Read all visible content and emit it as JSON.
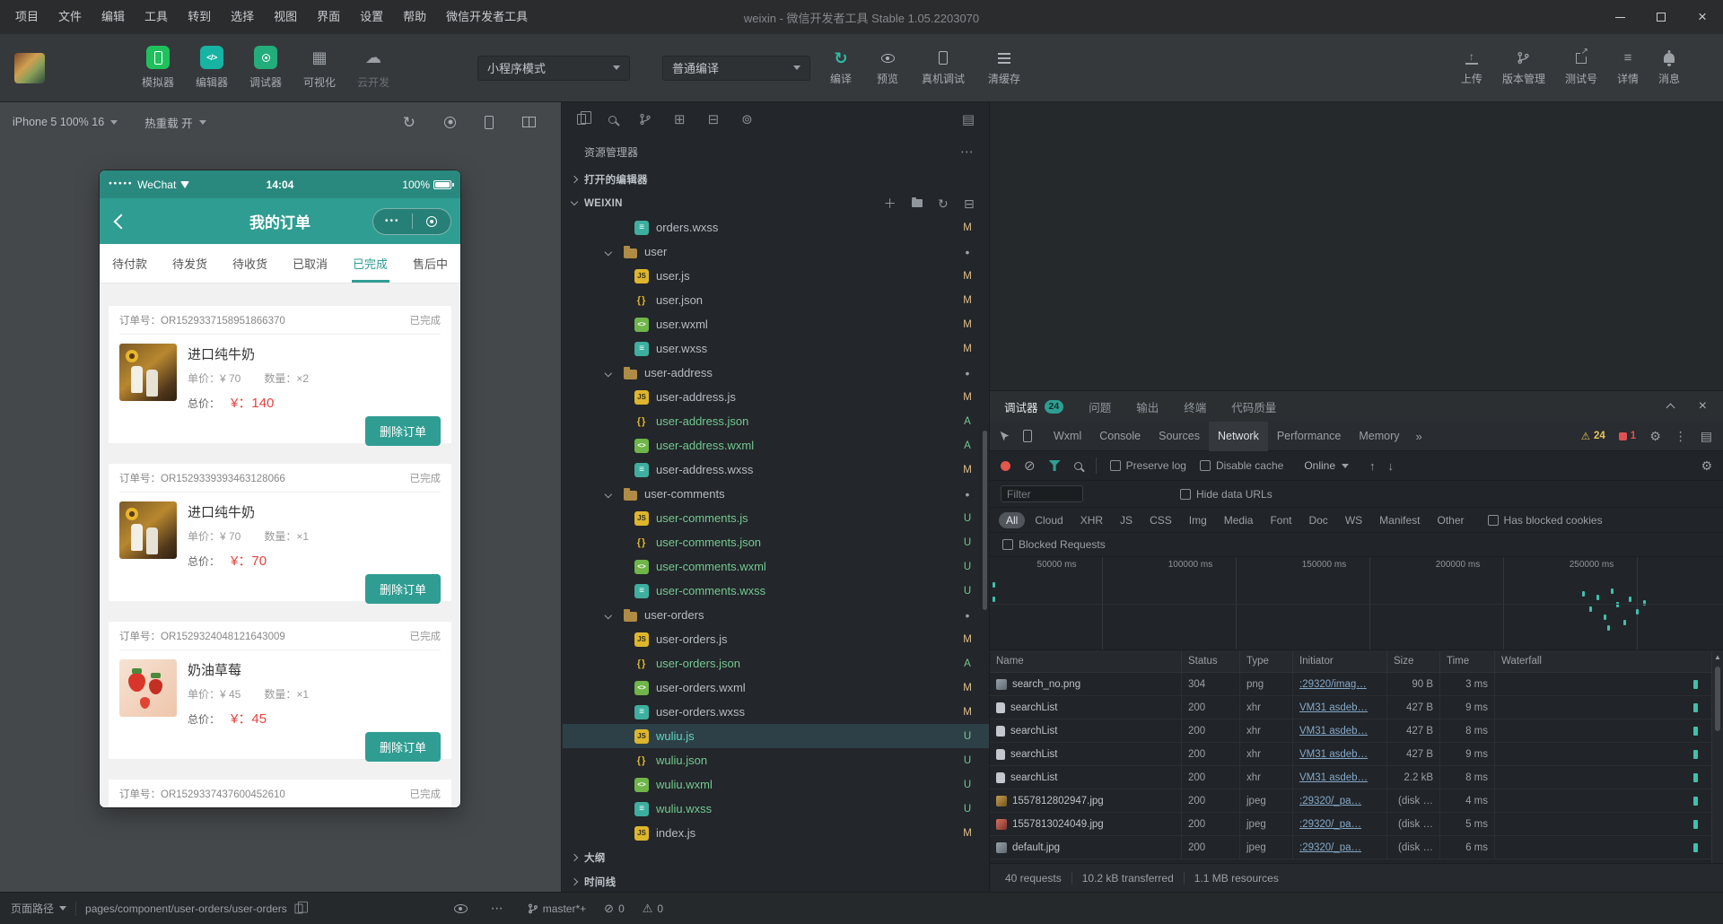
{
  "colors": {
    "accent_teal": "#2f9d92",
    "price_red": "#e64340",
    "badge_modified": "#e2c08d",
    "badge_added_untracked": "#73c991",
    "warning_yellow": "#e8c65a",
    "error_red": "#e05252"
  },
  "icons": {
    "refresh": "↻",
    "clear": "⊘",
    "error": "⊘",
    "gear": "⚙",
    "warning": "⚠",
    "more_v": "⋮",
    "more_h": "⋯",
    "overflow": "»",
    "grid": "▦",
    "cloud": "☁",
    "panel": "▤",
    "extensions": "⊞",
    "package": "⊟",
    "container": "⊚",
    "collapse_all": "⊟",
    "add": "＋",
    "up": "↑",
    "down": "↓",
    "external": "↗",
    "close": "×",
    "dots3": "•••",
    "signal": "●●●●●",
    "sort_up": "▲",
    "code": "</>"
  },
  "menu": {
    "items": [
      "项目",
      "文件",
      "编辑",
      "工具",
      "转到",
      "选择",
      "视图",
      "界面",
      "设置",
      "帮助",
      "微信开发者工具"
    ],
    "title": "weixin - 微信开发者工具 Stable 1.05.2203070"
  },
  "toolbar": {
    "modes": [
      {
        "label": "模拟器"
      },
      {
        "label": "编辑器"
      },
      {
        "label": "调试器"
      },
      {
        "label": "可视化"
      },
      {
        "label": "云开发"
      }
    ],
    "scheme": "小程序模式",
    "compile_mode": "普通编译",
    "compile": "编译",
    "preview": "预览",
    "device_debug": "真机调试",
    "clear_cache": "清缓存",
    "upload": "上传",
    "version": "版本管理",
    "test_account": "测试号",
    "details": "详情",
    "messages": "消息"
  },
  "simulator": {
    "device": "iPhone 5 100% 16",
    "hot_reload": "热重载 开"
  },
  "phone": {
    "carrier": "WeChat",
    "time": "14:04",
    "battery": "100%",
    "nav_title": "我的订单",
    "tabs": [
      {
        "label": "待付款",
        "active": false
      },
      {
        "label": "待发货",
        "active": false
      },
      {
        "label": "待收货",
        "active": false
      },
      {
        "label": "已取消",
        "active": false
      },
      {
        "label": "已完成",
        "active": true
      },
      {
        "label": "售后中",
        "active": false
      }
    ],
    "orders": [
      {
        "order_no": "订单号：OR1529337158951866370",
        "status": "已完成",
        "product": "进口纯牛奶",
        "unit_price": "单价：¥ 70",
        "quantity": "数量：×2",
        "total_label": "总价：",
        "total": "¥：140",
        "image": "milk",
        "delete_label": "删除订单"
      },
      {
        "order_no": "订单号：OR1529339393463128066",
        "status": "已完成",
        "product": "进口纯牛奶",
        "unit_price": "单价：¥ 70",
        "quantity": "数量：×1",
        "total_label": "总价：",
        "total": "¥：70",
        "image": "milk",
        "delete_label": "删除订单"
      },
      {
        "order_no": "订单号：OR1529324048121643009",
        "status": "已完成",
        "product": "奶油草莓",
        "unit_price": "单价：¥ 45",
        "quantity": "数量：×1",
        "total_label": "总价：",
        "total": "¥：45",
        "image": "strawberry",
        "delete_label": "删除订单"
      }
    ],
    "next_order": {
      "order_no": "订单号：OR1529337437600452610",
      "status": "已完成"
    }
  },
  "explorer": {
    "title": "资源管理器",
    "open_editors": "打开的编辑器",
    "project": "WEIXIN",
    "outline": "大纲",
    "timeline": "时间线",
    "tree": [
      {
        "name": "orders.wxss",
        "icon": "wxss",
        "badge": "M",
        "kind": "file"
      },
      {
        "name": "user",
        "icon": "folder",
        "badge": "•",
        "kind": "folder"
      },
      {
        "name": "user.js",
        "icon": "js",
        "badge": "M",
        "kind": "file"
      },
      {
        "name": "user.json",
        "icon": "json",
        "badge": "M",
        "kind": "file"
      },
      {
        "name": "user.wxml",
        "icon": "wxml",
        "badge": "M",
        "kind": "file"
      },
      {
        "name": "user.wxss",
        "icon": "wxss",
        "badge": "M",
        "kind": "file"
      },
      {
        "name": "user-address",
        "icon": "folder",
        "badge": "•",
        "kind": "folder"
      },
      {
        "name": "user-address.js",
        "icon": "js",
        "badge": "M",
        "kind": "file"
      },
      {
        "name": "user-address.json",
        "icon": "json",
        "badge": "A",
        "kind": "file"
      },
      {
        "name": "user-address.wxml",
        "icon": "wxml",
        "badge": "A",
        "kind": "file"
      },
      {
        "name": "user-address.wxss",
        "icon": "wxss",
        "badge": "M",
        "kind": "file"
      },
      {
        "name": "user-comments",
        "icon": "folder",
        "badge": "•",
        "kind": "folder"
      },
      {
        "name": "user-comments.js",
        "icon": "js",
        "badge": "U",
        "kind": "file"
      },
      {
        "name": "user-comments.json",
        "icon": "json",
        "badge": "U",
        "kind": "file"
      },
      {
        "name": "user-comments.wxml",
        "icon": "wxml",
        "badge": "U",
        "kind": "file"
      },
      {
        "name": "user-comments.wxss",
        "icon": "wxss",
        "badge": "U",
        "kind": "file"
      },
      {
        "name": "user-orders",
        "icon": "folder",
        "badge": "•",
        "kind": "folder"
      },
      {
        "name": "user-orders.js",
        "icon": "js",
        "badge": "M",
        "kind": "file"
      },
      {
        "name": "user-orders.json",
        "icon": "json",
        "badge": "A",
        "kind": "file"
      },
      {
        "name": "user-orders.wxml",
        "icon": "wxml",
        "badge": "M",
        "kind": "file"
      },
      {
        "name": "user-orders.wxss",
        "icon": "wxss",
        "badge": "M",
        "kind": "file"
      },
      {
        "name": "wuliu.js",
        "icon": "js",
        "badge": "U",
        "kind": "file",
        "selected": true
      },
      {
        "name": "wuliu.json",
        "icon": "json",
        "badge": "U",
        "kind": "file"
      },
      {
        "name": "wuliu.wxml",
        "icon": "wxml",
        "badge": "U",
        "kind": "file"
      },
      {
        "name": "wuliu.wxss",
        "icon": "wxss",
        "badge": "U",
        "kind": "file"
      },
      {
        "name": "index.js",
        "icon": "js",
        "badge": "M",
        "kind": "file"
      }
    ]
  },
  "devtools": {
    "panel_tabs": [
      {
        "label": "调试器",
        "badge": "24",
        "active": true
      },
      {
        "label": "问题",
        "active": false
      },
      {
        "label": "输出",
        "active": false
      },
      {
        "label": "终端",
        "active": false
      },
      {
        "label": "代码质量",
        "active": false
      }
    ],
    "tabs": [
      {
        "label": "Wxml",
        "active": false
      },
      {
        "label": "Console",
        "active": false
      },
      {
        "label": "Sources",
        "active": false
      },
      {
        "label": "Network",
        "active": true
      },
      {
        "label": "Performance",
        "active": false
      },
      {
        "label": "Memory",
        "active": false
      }
    ],
    "warn_count": "24",
    "error_count": "1",
    "network": {
      "preserve_log": "Preserve log",
      "disable_cache": "Disable cache",
      "throttle": "Online",
      "filter_placeholder": "Filter",
      "hide_data_urls": "Hide data URLs",
      "filters": [
        {
          "label": "All",
          "active": true
        },
        {
          "label": "Cloud",
          "active": false
        },
        {
          "label": "XHR",
          "active": false
        },
        {
          "label": "JS",
          "active": false
        },
        {
          "label": "CSS",
          "active": false
        },
        {
          "label": "Img",
          "active": false
        },
        {
          "label": "Media",
          "active": false
        },
        {
          "label": "Font",
          "active": false
        },
        {
          "label": "Doc",
          "active": false
        },
        {
          "label": "WS",
          "active": false
        },
        {
          "label": "Manifest",
          "active": false
        },
        {
          "label": "Other",
          "active": false
        }
      ],
      "has_blocked_cookies": "Has blocked cookies",
      "blocked_requests": "Blocked Requests",
      "timeline_ticks": [
        "50000 ms",
        "100000 ms",
        "150000 ms",
        "200000 ms",
        "250000 ms"
      ],
      "columns": [
        "Name",
        "Status",
        "Type",
        "Initiator",
        "Size",
        "Time",
        "Waterfall"
      ],
      "rows": [
        {
          "name": "search_no.png",
          "status": "304",
          "type": "png",
          "initiator": ":29320/imag…",
          "size": "90 B",
          "time": "3 ms",
          "icon": "image-gray"
        },
        {
          "name": "searchList",
          "status": "200",
          "type": "xhr",
          "initiator": "VM31 asdeb…",
          "size": "427 B",
          "time": "9 ms",
          "icon": "doc"
        },
        {
          "name": "searchList",
          "status": "200",
          "type": "xhr",
          "initiator": "VM31 asdeb…",
          "size": "427 B",
          "time": "8 ms",
          "icon": "doc"
        },
        {
          "name": "searchList",
          "status": "200",
          "type": "xhr",
          "initiator": "VM31 asdeb…",
          "size": "427 B",
          "time": "9 ms",
          "icon": "doc"
        },
        {
          "name": "searchList",
          "status": "200",
          "type": "xhr",
          "initiator": "VM31 asdeb…",
          "size": "2.2 kB",
          "time": "8 ms",
          "icon": "doc"
        },
        {
          "name": "1557812802947.jpg",
          "status": "200",
          "type": "jpeg",
          "initiator": ":29320/_pa…",
          "size": "(disk …",
          "time": "4 ms",
          "icon": "image-amber"
        },
        {
          "name": "1557813024049.jpg",
          "status": "200",
          "type": "jpeg",
          "initiator": ":29320/_pa…",
          "size": "(disk …",
          "time": "5 ms",
          "icon": "image-red"
        },
        {
          "name": "default.jpg",
          "status": "200",
          "type": "jpeg",
          "initiator": ":29320/_pa…",
          "size": "(disk …",
          "time": "6 ms",
          "icon": "image-gray"
        }
      ],
      "summary": [
        "40 requests",
        "10.2 kB transferred",
        "1.1 MB resources"
      ]
    }
  },
  "statusbar": {
    "page_path_label": "页面路径",
    "path": "pages/component/user-orders/user-orders",
    "branch": "master*+",
    "errors": "0",
    "warnings": "0"
  }
}
